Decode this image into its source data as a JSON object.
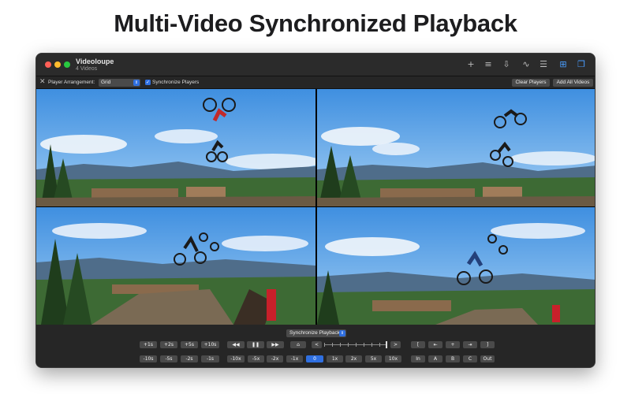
{
  "headline": "Multi-Video Synchronized Playback",
  "window": {
    "title": "Videoloupe",
    "subtitle": "4 Videos"
  },
  "toolbar": {
    "icons": [
      "plus-icon",
      "list-icon",
      "export-icon",
      "waveform-icon",
      "sliders-icon",
      "grid-icon",
      "window-icon"
    ],
    "active_color": "#4a9eff"
  },
  "options": {
    "arrangement_label": "Player Arrangement:",
    "arrangement_value": "Grid",
    "sync_checkbox_label": "Synchronize Players",
    "sync_checked": true,
    "clear_players": "Clear Players",
    "add_all_videos": "Add All Videos"
  },
  "videos": [
    {
      "id": "video-1"
    },
    {
      "id": "video-2"
    },
    {
      "id": "video-3"
    },
    {
      "id": "video-4"
    }
  ],
  "controls": {
    "sync_select": "Synchronize Playback",
    "forward_steps": [
      "+1s",
      "+2s",
      "+5s",
      "+10s"
    ],
    "back_steps": [
      "-10s",
      "-5s",
      "-2s",
      "-1s"
    ],
    "transport": [
      "◀◀",
      "❚❚",
      "▶▶",
      "⌂"
    ],
    "scrub_prev": "<",
    "scrub_next": ">",
    "speed_back": [
      "-10x",
      "-5x",
      "-2x",
      "-1x"
    ],
    "speed_zero": "0",
    "speed_forward": [
      "1x",
      "2x",
      "5x",
      "10x"
    ],
    "marker_top": [
      "[",
      "⇤",
      "+",
      "⇥",
      "]"
    ],
    "marker_bottom": [
      "In",
      "A",
      "B",
      "C",
      "Out"
    ],
    "accent": "#2f6fe0"
  }
}
